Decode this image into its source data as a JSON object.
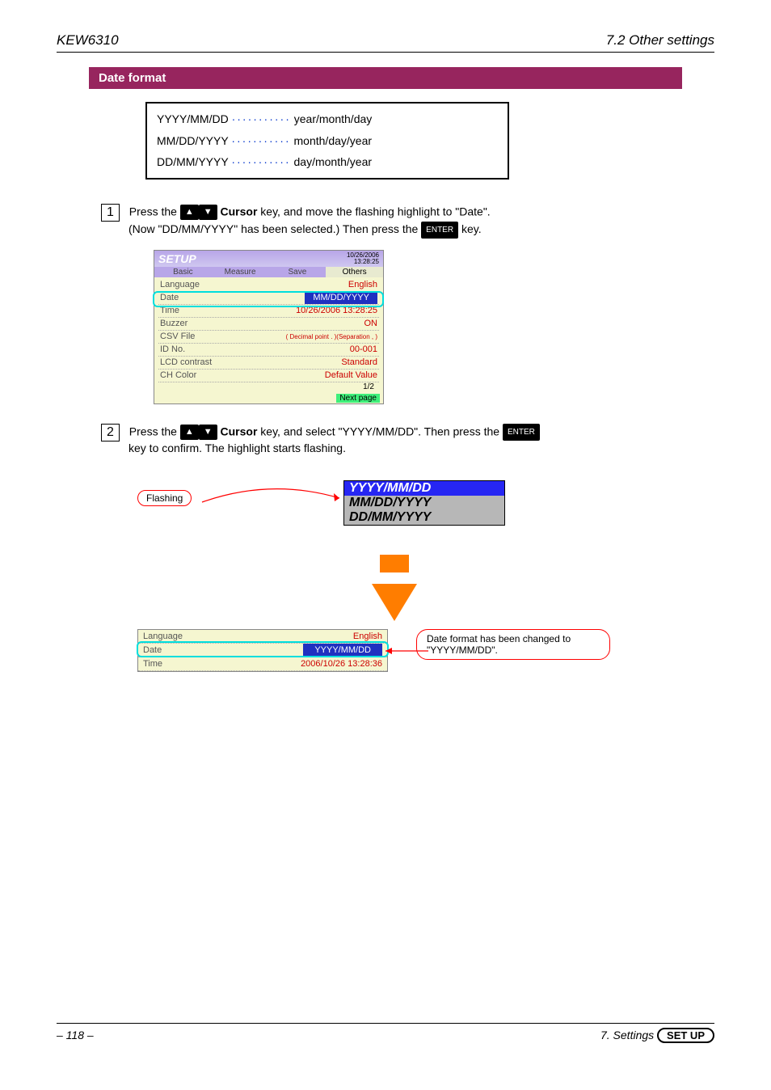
{
  "header": {
    "left": "KEW6310",
    "right": "7.2 Other settings"
  },
  "section": {
    "title": "Date format",
    "box": {
      "line1_left": "YYYY/MM/DD",
      "dots": "···········",
      "line1_right": "year/month/day",
      "line2_left": "MM/DD/YYYY",
      "line2_right": "month/day/year",
      "line3_left": "DD/MM/YYYY",
      "line3_right": "day/month/year"
    }
  },
  "step1": {
    "num": "1",
    "pre": "Press the",
    "cursor": "Cursor",
    "mid": "key, and move the flashing highlight to \"Date\".",
    "post": "(Now \"DD/MM/YYYY\" has been selected.) Then press the",
    "enter": "ENTER",
    "end": "key."
  },
  "screenshot1": {
    "title": "SETUP",
    "timestamp_top": "10/26/2006",
    "timestamp_bot": "13:28:25",
    "tabs": [
      "Basic",
      "Measure",
      "Save",
      "Others"
    ],
    "rows": [
      {
        "lbl": "Language",
        "val": "English"
      },
      {
        "lbl": "Date",
        "val": "MM/DD/YYYY",
        "sel": true
      },
      {
        "lbl": "Time",
        "val": "10/26/2006 13:28:25"
      },
      {
        "lbl": "Buzzer",
        "val": "ON"
      },
      {
        "lbl": "CSV File",
        "val": "( Decimal point . )(Separation , )"
      },
      {
        "lbl": "ID No.",
        "val": "00-001"
      },
      {
        "lbl": "LCD contrast",
        "val": "Standard"
      },
      {
        "lbl": "CH Color",
        "val": "Default Value"
      }
    ],
    "page": "1/2",
    "next": "Next page"
  },
  "step2": {
    "num": "2",
    "pre": "Press the",
    "cursor": "Cursor",
    "mid": "key, and select \"YYYY/MM/DD\". Then press the",
    "enter": "ENTER",
    "end": "key to confirm. The highlight starts flashing."
  },
  "callout_left": "Flashing",
  "popup": {
    "options": [
      "YYYY/MM/DD",
      "MM/DD/YYYY",
      "DD/MM/YYYY"
    ],
    "selected": 0
  },
  "screenshot2": {
    "rows": [
      {
        "lbl": "Language",
        "val": "English"
      },
      {
        "lbl": "Date",
        "val": "YYYY/MM/DD",
        "sel": true
      },
      {
        "lbl": "Time",
        "val": "2006/10/26 13:28:36"
      }
    ]
  },
  "callout_right": "Date format has been changed to \"YYYY/MM/DD\".",
  "footer": {
    "left": "– 118 –",
    "right_prefix": "7. Settings",
    "pill": "SET UP"
  }
}
